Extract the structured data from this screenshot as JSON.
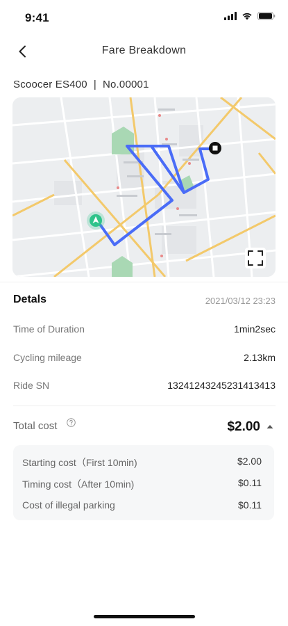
{
  "status_bar": {
    "time": "9:41",
    "icons": [
      "cellular-signal-icon",
      "wifi-icon",
      "battery-icon"
    ]
  },
  "nav": {
    "title": "Fare Breakdown",
    "back_icon": "chevron-left-icon"
  },
  "vehicle": {
    "model": "Scoocer ES400",
    "number": "No.00001"
  },
  "map": {
    "route_color": "#4a6cf7",
    "start_marker_color": "#2fc38a",
    "end_marker_color": "#111111",
    "expand_icon": "fullscreen-expand-icon"
  },
  "details": {
    "title": "Detals",
    "datetime": "2021/03/12 23:23",
    "rows": [
      {
        "label": "Time of Duration",
        "value": "1min2sec"
      },
      {
        "label": "Cycling mileage",
        "value": "2.13km"
      },
      {
        "label": "Ride SN",
        "value": "13241243245231413413"
      }
    ]
  },
  "total": {
    "label": "Total cost",
    "amount": "$2.00",
    "help_icon": "question-circle-icon",
    "toggle_icon": "caret-up-icon"
  },
  "costs": [
    {
      "label": "Starting cost（First 10min)",
      "value": "$2.00"
    },
    {
      "label": "Timing cost（After 10min)",
      "value": "$0.11"
    },
    {
      "label": "Cost of illegal parking",
      "value": "$0.11"
    }
  ]
}
